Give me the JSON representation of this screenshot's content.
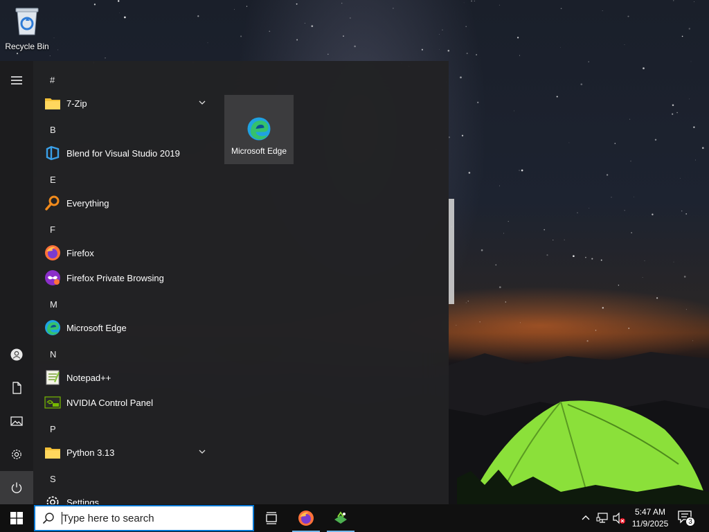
{
  "desktop": {
    "icons": [
      {
        "label": "Recycle Bin",
        "icon": "recycle-bin-icon"
      }
    ]
  },
  "start_menu": {
    "rail": {
      "menu_icon": "hamburger-icon",
      "bottom_items": [
        {
          "icon": "user-icon"
        },
        {
          "icon": "documents-icon"
        },
        {
          "icon": "pictures-icon"
        },
        {
          "icon": "settings-icon"
        },
        {
          "icon": "power-icon"
        }
      ]
    },
    "groups": [
      {
        "letter": "#",
        "apps": [
          {
            "name": "7-Zip",
            "icon": "folder-icon",
            "expandable": true
          }
        ]
      },
      {
        "letter": "B",
        "apps": [
          {
            "name": "Blend for Visual Studio 2019",
            "icon": "blend-icon"
          }
        ]
      },
      {
        "letter": "E",
        "apps": [
          {
            "name": "Everything",
            "icon": "everything-search-icon"
          }
        ]
      },
      {
        "letter": "F",
        "apps": [
          {
            "name": "Firefox",
            "icon": "firefox-icon"
          },
          {
            "name": "Firefox Private Browsing",
            "icon": "firefox-private-icon"
          }
        ]
      },
      {
        "letter": "M",
        "apps": [
          {
            "name": "Microsoft Edge",
            "icon": "edge-icon"
          }
        ]
      },
      {
        "letter": "N",
        "apps": [
          {
            "name": "Notepad++",
            "icon": "notepadpp-icon"
          },
          {
            "name": "NVIDIA Control Panel",
            "icon": "nvidia-icon"
          }
        ]
      },
      {
        "letter": "P",
        "apps": [
          {
            "name": "Python 3.13",
            "icon": "folder-icon",
            "expandable": true
          }
        ]
      },
      {
        "letter": "S",
        "apps": [
          {
            "name": "Settings",
            "icon": "settings-icon"
          }
        ]
      }
    ],
    "tiles": [
      {
        "label": "Microsoft Edge",
        "icon": "edge-icon"
      }
    ]
  },
  "taskbar": {
    "start_icon": "windows-logo-icon",
    "search": {
      "placeholder": "Type here to search",
      "value": ""
    },
    "pinned": [
      {
        "name": "Task View",
        "icon": "task-view-icon"
      },
      {
        "name": "Firefox",
        "icon": "firefox-icon",
        "running": true
      },
      {
        "name": "Terminal",
        "icon": "app-icon",
        "running": true
      }
    ],
    "tray": {
      "icons": [
        "chevron-up-icon",
        "network-icon",
        "volume-muted-icon"
      ],
      "time": "5:47 AM",
      "date": "11/9/2025",
      "notification_count": "3"
    }
  },
  "colors": {
    "accent": "#0078d4",
    "start_bg": "#222224",
    "tile_bg": "#3c3c3e",
    "taskbar_bg": "#101010",
    "tent_green": "#8be03a"
  }
}
